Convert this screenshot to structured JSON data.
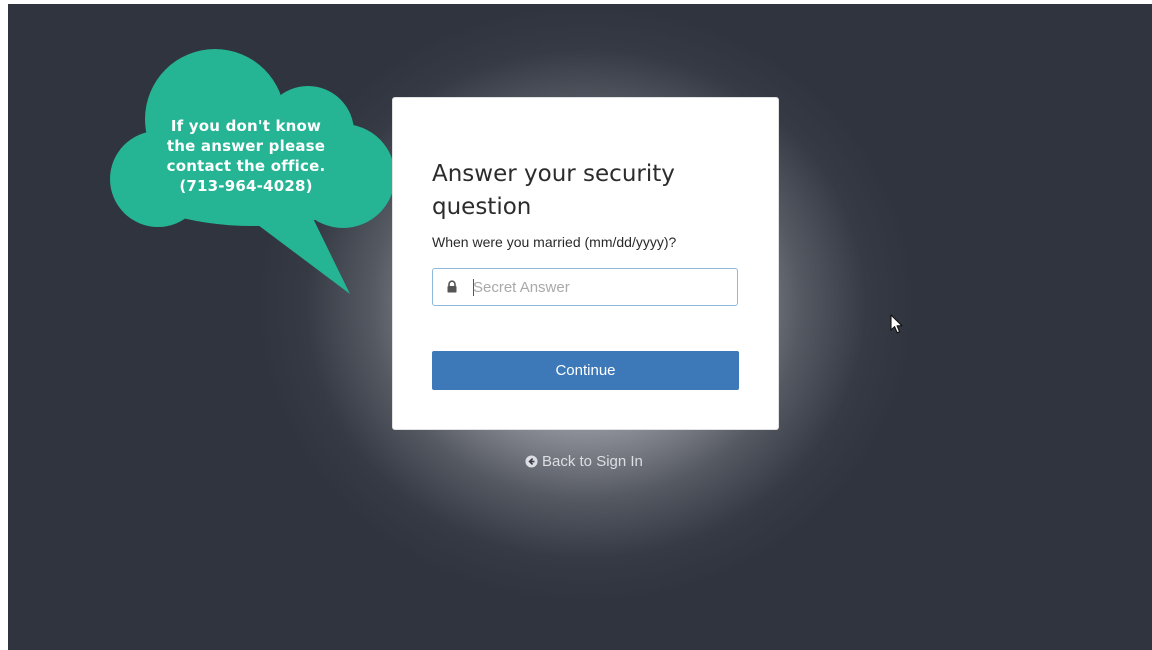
{
  "callout": {
    "lines": [
      "If you don't know",
      "the answer please",
      "contact the office.",
      "(713-964-4028)"
    ],
    "color": "#25b494"
  },
  "card": {
    "title": "Answer your security question",
    "question": "When were you married (mm/dd/yyyy)?",
    "answer_field": {
      "value": "",
      "placeholder": "Secret Answer",
      "icon": "lock-icon"
    },
    "continue_label": "Continue",
    "button_color": "#3d79b8"
  },
  "back_link": {
    "label": "Back to Sign In",
    "icon": "arrow-circle-left-icon"
  }
}
